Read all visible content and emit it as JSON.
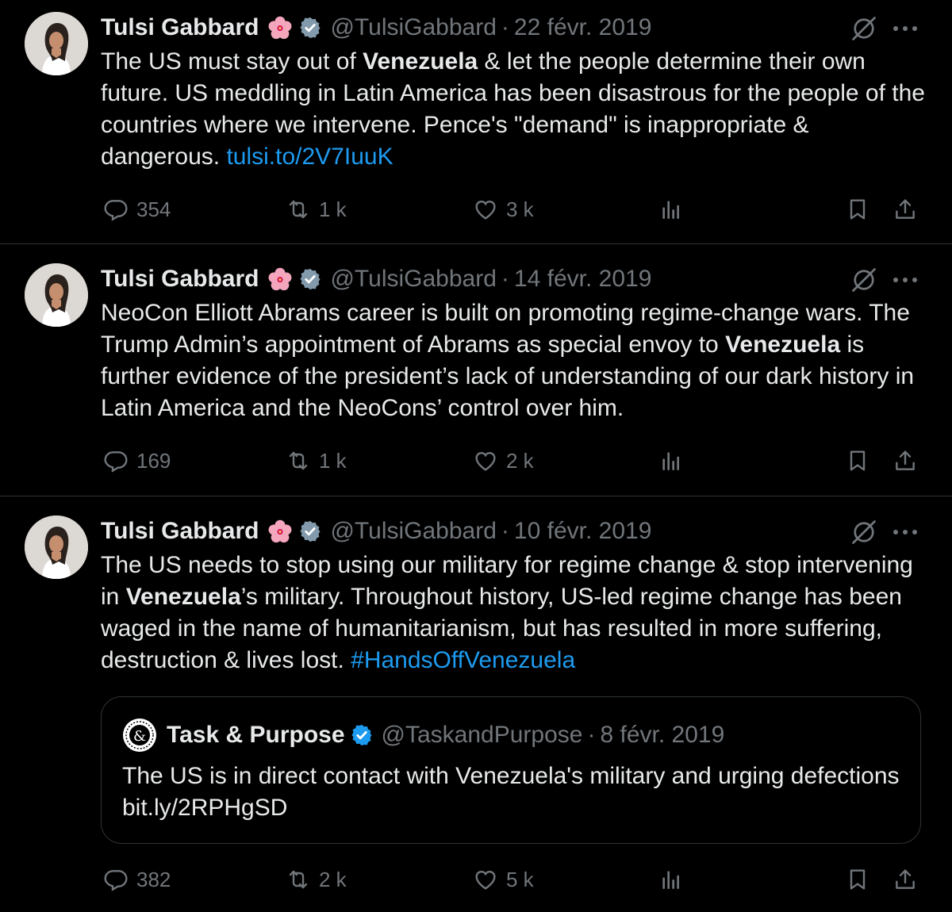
{
  "tweets": [
    {
      "author": {
        "name": "Tulsi Gabbard",
        "handle": "@TulsiGabbard",
        "flower_emoji": "hibiscus-emoji",
        "verified_color": "#829aab"
      },
      "separator": "·",
      "date": "22 févr. 2019",
      "text": {
        "p1": "The US must stay out of ",
        "b1": "Venezuela",
        "p2": " & let the people determine their own future. US meddling in Latin America has been disastrous for the people of the countries where we intervene. Pence's \"demand\" is inappropriate & dangerous. ",
        "link": "tulsi.to/2V7IuuK"
      },
      "stats": {
        "replies": "354",
        "reposts": "1 k",
        "likes": "3 k"
      }
    },
    {
      "author": {
        "name": "Tulsi Gabbard",
        "handle": "@TulsiGabbard"
      },
      "separator": "·",
      "date": "14 févr. 2019",
      "text": {
        "p1": "NeoCon Elliott Abrams career is built on promoting regime-change wars. The Trump Admin’s appointment of Abrams as special envoy to ",
        "b1": "Venezuela",
        "p2": " is further evidence of the president’s lack of understanding of our dark history in Latin America and the NeoCons’ control over him."
      },
      "stats": {
        "replies": "169",
        "reposts": "1 k",
        "likes": "2 k"
      }
    },
    {
      "author": {
        "name": "Tulsi Gabbard",
        "handle": "@TulsiGabbard"
      },
      "separator": "·",
      "date": "10 févr. 2019",
      "text": {
        "p1": "The US needs to stop using our military for regime change & stop intervening in ",
        "b1": "Venezuela",
        "p2": "’s military. Throughout history, US-led regime change has been waged in the name of humanitarianism, but has resulted in more suffering, destruction & lives lost.  ",
        "hashtag": "#HandsOffVenezuela"
      },
      "quote": {
        "author": {
          "name": "Task & Purpose",
          "handle": "@TaskandPurpose",
          "logo_text": "&",
          "verified_color": "#1d9bf0"
        },
        "separator": "·",
        "date": "8 févr. 2019",
        "text": "The US is in direct contact with Venezuela's military and urging defections bit.ly/2RPHgSD"
      },
      "stats": {
        "replies": "382",
        "reposts": "2 k",
        "likes": "5 k"
      }
    }
  ],
  "colors": {
    "background": "#000000",
    "text": "#e7e9ea",
    "muted": "#71767b",
    "link": "#1d9bf0",
    "divider": "#2f3336"
  }
}
